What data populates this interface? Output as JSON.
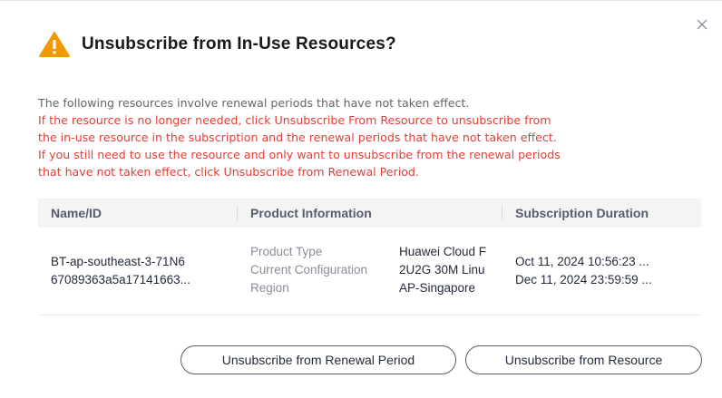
{
  "dialog": {
    "title": "Unsubscribe from In-Use Resources?",
    "description_gray": "The following resources involve renewal periods that have not taken effect.",
    "description_red_lines": [
      "If the resource is no longer needed, click Unsubscribe From Resource to unsubscribe from",
      "the in-use resource in the subscription and the renewal periods that have not taken effect.",
      "If you still need to use the resource and only want to unsubscribe from the renewal periods",
      "that have not taken effect, click Unsubscribe from Renewal Period."
    ],
    "colors": {
      "warning": "#f09a00",
      "red_text": "#e43d36",
      "gray_text": "#666666",
      "header_bg": "#f4f4f5"
    }
  },
  "table": {
    "headers": [
      "Name/ID",
      "Product Information",
      "Subscription Duration"
    ],
    "row": {
      "name": "BT-ap-southeast-3-71N6",
      "id": "67089363a5a17141663...",
      "product_labels": [
        "Product Type",
        "Current Configuration",
        "Region"
      ],
      "product_values": [
        "Huawei Cloud F",
        "2U2G 30M Linu",
        "AP-Singapore"
      ],
      "duration": [
        "Oct 11, 2024 10:56:23 ...",
        "Dec 11, 2024 23:59:59 ..."
      ]
    }
  },
  "buttons": {
    "renewal": "Unsubscribe from Renewal Period",
    "resource": "Unsubscribe from Resource"
  },
  "icons": {
    "close": "close-icon",
    "warning": "warning-triangle-icon"
  }
}
